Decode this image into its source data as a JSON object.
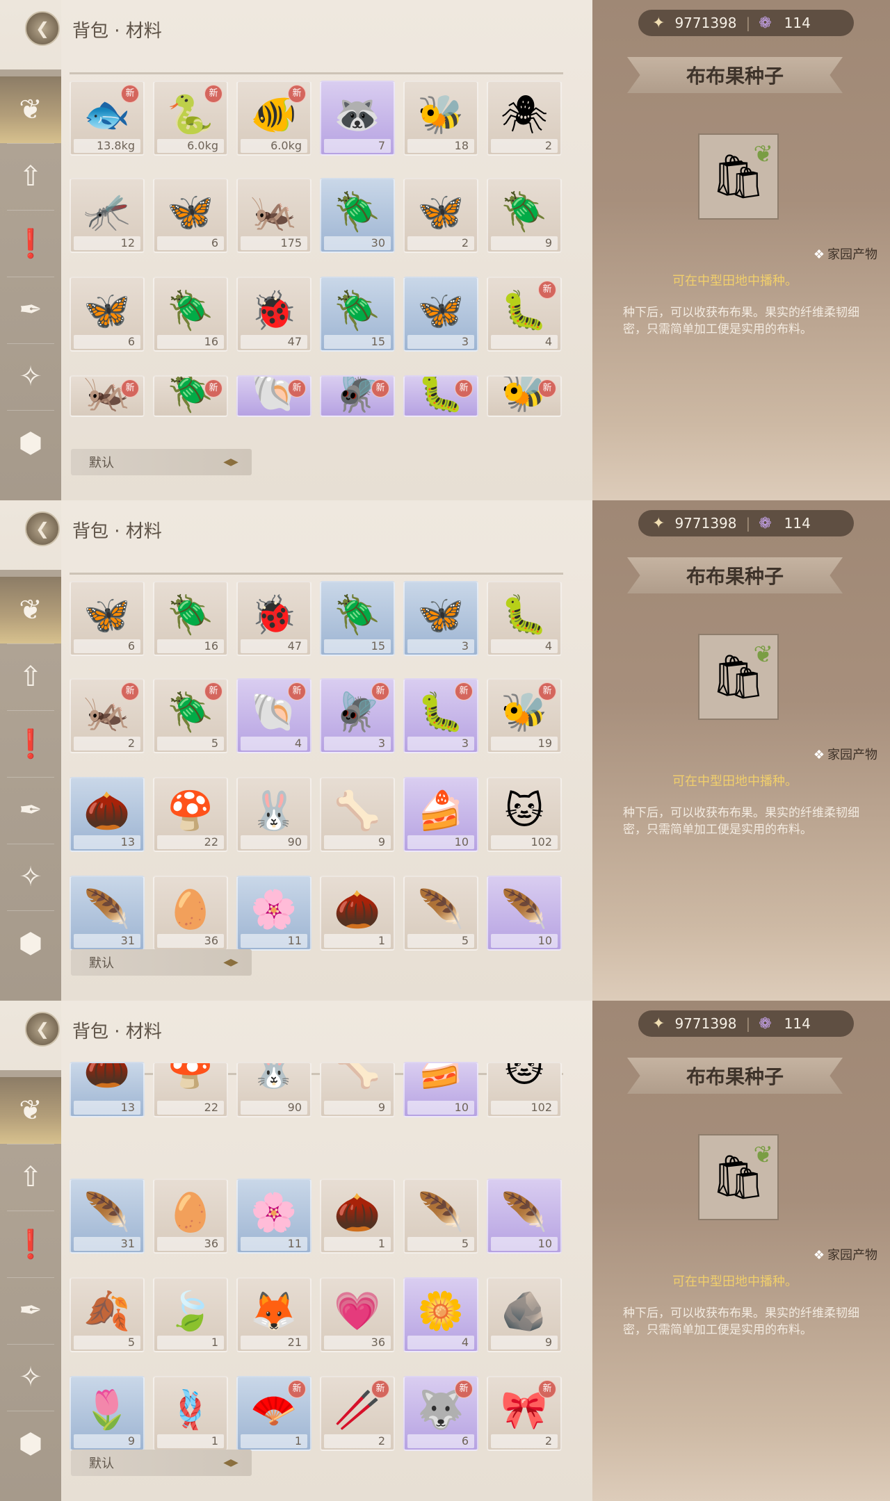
{
  "header": {
    "back_icon": "back-arrow-icon",
    "title": "背包 · 材料"
  },
  "sidebar_icons": [
    "bag-icon",
    "upgrade-icon",
    "quest-icon",
    "feather-pen-icon",
    "sparkle-icon",
    "box-icon"
  ],
  "sort": {
    "label": "默认",
    "toggle_icon": "sort-toggle-icon"
  },
  "detail": {
    "gold": "9771398",
    "gems": "114",
    "item_name": "布布果种子",
    "category": "家园产物",
    "usage": "可在中型田地中播种。",
    "description": "种下后，可以收获布布果。果实的纤维柔韧细密，只需简单加工便是实用的布料。"
  },
  "colors": {
    "accent_gold": "#f1cf6c",
    "new_badge": "#d4665d",
    "detail_bg": "#a38c78"
  },
  "panels": [
    {
      "rows": [
        [
          {
            "icon": "🐟",
            "count": "13.8kg",
            "bg": "tan",
            "new": true
          },
          {
            "icon": "🐍",
            "count": "6.0kg",
            "bg": "tan",
            "new": true
          },
          {
            "icon": "🐠",
            "count": "6.0kg",
            "bg": "tan",
            "new": true
          },
          {
            "icon": "🦝",
            "count": "7",
            "bg": "purple",
            "new": false
          },
          {
            "icon": "🐝",
            "count": "18",
            "bg": "tan",
            "new": false
          },
          {
            "icon": "🕷",
            "count": "2",
            "bg": "tan",
            "new": false
          }
        ],
        [
          {
            "icon": "🦟",
            "count": "12",
            "bg": "tan",
            "new": false
          },
          {
            "icon": "🦋",
            "count": "6",
            "bg": "tan",
            "new": false
          },
          {
            "icon": "🦗",
            "count": "175",
            "bg": "tan",
            "new": false
          },
          {
            "icon": "🪲",
            "count": "30",
            "bg": "blue",
            "new": false
          },
          {
            "icon": "🦋",
            "count": "2",
            "bg": "tan",
            "new": false
          },
          {
            "icon": "🪲",
            "count": "9",
            "bg": "tan",
            "new": false
          }
        ],
        [
          {
            "icon": "🦋",
            "count": "6",
            "bg": "tan",
            "new": false
          },
          {
            "icon": "🪲",
            "count": "16",
            "bg": "tan",
            "new": false
          },
          {
            "icon": "🐞",
            "count": "47",
            "bg": "tan",
            "new": false
          },
          {
            "icon": "🪲",
            "count": "15",
            "bg": "blue",
            "new": false
          },
          {
            "icon": "🦋",
            "count": "3",
            "bg": "blue",
            "new": false
          },
          {
            "icon": "🐛",
            "count": "4",
            "bg": "tan",
            "new": true
          }
        ],
        [
          {
            "icon": "🦗",
            "count": "",
            "bg": "tan",
            "new": true
          },
          {
            "icon": "🪲",
            "count": "",
            "bg": "tan",
            "new": true
          },
          {
            "icon": "🐚",
            "count": "",
            "bg": "purple",
            "new": true
          },
          {
            "icon": "🪰",
            "count": "",
            "bg": "purple",
            "new": true
          },
          {
            "icon": "🐛",
            "count": "",
            "bg": "purple",
            "new": true
          },
          {
            "icon": "🐝",
            "count": "",
            "bg": "tan",
            "new": true
          }
        ]
      ]
    },
    {
      "rows": [
        [
          {
            "icon": "🦋",
            "count": "6",
            "bg": "tan",
            "new": false
          },
          {
            "icon": "🪲",
            "count": "16",
            "bg": "tan",
            "new": false
          },
          {
            "icon": "🐞",
            "count": "47",
            "bg": "tan",
            "new": false
          },
          {
            "icon": "🪲",
            "count": "15",
            "bg": "blue",
            "new": false
          },
          {
            "icon": "🦋",
            "count": "3",
            "bg": "blue",
            "new": false
          },
          {
            "icon": "🐛",
            "count": "4",
            "bg": "tan",
            "new": false
          }
        ],
        [
          {
            "icon": "🦗",
            "count": "2",
            "bg": "tan",
            "new": true
          },
          {
            "icon": "🪲",
            "count": "5",
            "bg": "tan",
            "new": true
          },
          {
            "icon": "🐚",
            "count": "4",
            "bg": "purple",
            "new": true
          },
          {
            "icon": "🪰",
            "count": "3",
            "bg": "purple",
            "new": true
          },
          {
            "icon": "🐛",
            "count": "3",
            "bg": "purple",
            "new": true
          },
          {
            "icon": "🐝",
            "count": "19",
            "bg": "tan",
            "new": true
          }
        ],
        [
          {
            "icon": "🌰",
            "count": "13",
            "bg": "blue",
            "new": false
          },
          {
            "icon": "🍄",
            "count": "22",
            "bg": "tan",
            "new": false
          },
          {
            "icon": "🐰",
            "count": "90",
            "bg": "tan",
            "new": false
          },
          {
            "icon": "🦴",
            "count": "9",
            "bg": "tan",
            "new": false
          },
          {
            "icon": "🍰",
            "count": "10",
            "bg": "purple",
            "new": false
          },
          {
            "icon": "🐱",
            "count": "102",
            "bg": "tan",
            "new": false
          }
        ],
        [
          {
            "icon": "🪶",
            "count": "31",
            "bg": "blue",
            "new": false
          },
          {
            "icon": "🥚",
            "count": "36",
            "bg": "tan",
            "new": false
          },
          {
            "icon": "🌸",
            "count": "11",
            "bg": "blue",
            "new": false
          },
          {
            "icon": "🌰",
            "count": "1",
            "bg": "tan",
            "new": false
          },
          {
            "icon": "🪶",
            "count": "5",
            "bg": "tan",
            "new": false
          },
          {
            "icon": "🪶",
            "count": "10",
            "bg": "purple",
            "new": false
          }
        ]
      ]
    },
    {
      "rows": [
        [
          {
            "icon": "🌰",
            "count": "13",
            "bg": "blue",
            "new": false,
            "partial": true
          },
          {
            "icon": "🍄",
            "count": "22",
            "bg": "tan",
            "new": false,
            "partial": true
          },
          {
            "icon": "🐰",
            "count": "90",
            "bg": "tan",
            "new": false,
            "partial": true
          },
          {
            "icon": "🦴",
            "count": "9",
            "bg": "tan",
            "new": false,
            "partial": true
          },
          {
            "icon": "🍰",
            "count": "10",
            "bg": "purple",
            "new": false,
            "partial": true
          },
          {
            "icon": "🐱",
            "count": "102",
            "bg": "tan",
            "new": false,
            "partial": true
          }
        ],
        [
          {
            "icon": "🪶",
            "count": "31",
            "bg": "blue",
            "new": false
          },
          {
            "icon": "🥚",
            "count": "36",
            "bg": "tan",
            "new": false
          },
          {
            "icon": "🌸",
            "count": "11",
            "bg": "blue",
            "new": false
          },
          {
            "icon": "🌰",
            "count": "1",
            "bg": "tan",
            "new": false
          },
          {
            "icon": "🪶",
            "count": "5",
            "bg": "tan",
            "new": false
          },
          {
            "icon": "🪶",
            "count": "10",
            "bg": "purple",
            "new": false
          }
        ],
        [
          {
            "icon": "🍂",
            "count": "5",
            "bg": "tan",
            "new": false
          },
          {
            "icon": "🍃",
            "count": "1",
            "bg": "tan",
            "new": false
          },
          {
            "icon": "🦊",
            "count": "21",
            "bg": "tan",
            "new": false
          },
          {
            "icon": "💗",
            "count": "36",
            "bg": "tan",
            "new": false
          },
          {
            "icon": "🌼",
            "count": "4",
            "bg": "purple",
            "new": false
          },
          {
            "icon": "🪨",
            "count": "9",
            "bg": "tan",
            "new": false
          }
        ],
        [
          {
            "icon": "🌷",
            "count": "9",
            "bg": "blue",
            "new": false
          },
          {
            "icon": "🪢",
            "count": "1",
            "bg": "tan",
            "new": false
          },
          {
            "icon": "🪭",
            "count": "1",
            "bg": "blue",
            "new": true
          },
          {
            "icon": "🥢",
            "count": "2",
            "bg": "tan",
            "new": true
          },
          {
            "icon": "🐺",
            "count": "6",
            "bg": "purple",
            "new": true
          },
          {
            "icon": "🎀",
            "count": "2",
            "bg": "tan",
            "new": true
          }
        ]
      ]
    }
  ]
}
